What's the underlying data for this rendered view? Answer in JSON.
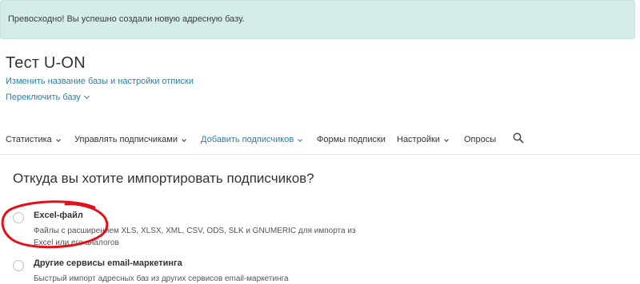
{
  "alert": {
    "message": "Превосходно! Вы успешно создали новую адресную базу."
  },
  "list": {
    "title": "Тест U-ON",
    "rename_link": "Изменить название базы и настройки отписки",
    "switch_link": "Переключить базу"
  },
  "nav": {
    "items": [
      {
        "label": "Статистика",
        "dropdown": true,
        "active": false
      },
      {
        "label": "Управлять подписчиками",
        "dropdown": true,
        "active": false
      },
      {
        "label": "Добавить подписчиков",
        "dropdown": true,
        "active": true
      },
      {
        "label": "Формы подписки",
        "dropdown": false,
        "active": false
      },
      {
        "label": "Настройки",
        "dropdown": true,
        "active": false
      },
      {
        "label": "Опросы",
        "dropdown": false,
        "active": false
      }
    ],
    "search_icon": "search-icon"
  },
  "import": {
    "question": "Откуда вы хотите импортировать подписчиков?",
    "options": [
      {
        "title": "Excel-файл",
        "description": "Файлы с расширением XLS, XLSX, XML, CSV, ODS, SLK и GNUMERIC для импорта из Excel или его аналогов",
        "selected": false
      },
      {
        "title": "Другие сервисы email-маркетинга",
        "description": "Быстрый импорт адресных баз из других сервисов email-маркетинга",
        "selected": false
      }
    ]
  },
  "colors": {
    "alert_bg": "#d4ede9",
    "link": "#2a7fa8",
    "annotation": "#e3101a"
  }
}
